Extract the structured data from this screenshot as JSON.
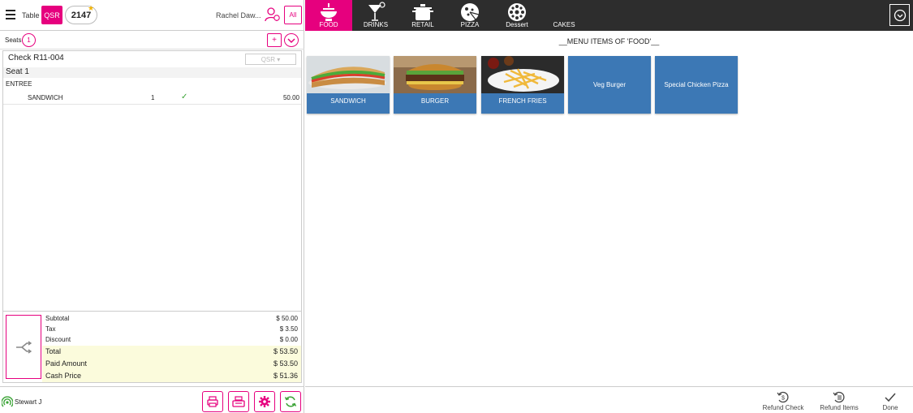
{
  "header": {
    "table_label": "Table",
    "order_type": "QSR",
    "table_number": "2147",
    "user_name": "Rachel Daw...",
    "filter_all": "All"
  },
  "seats": {
    "label": "Seats",
    "count": "1",
    "add": "+"
  },
  "check": {
    "title": "Check R11-004",
    "type_dropdown": "QSR ▾",
    "seat_heading": "Seat 1",
    "course": "ENTREE",
    "items": [
      {
        "name": "SANDWICH",
        "qty": "1",
        "amount": "50.00"
      }
    ]
  },
  "totals": {
    "subtotal_label": "Subtotal",
    "subtotal": "$ 50.00",
    "tax_label": "Tax",
    "tax": "$ 3.50",
    "discount_label": "Discount",
    "discount": "$ 0.00",
    "total_label": "Total",
    "total": "$ 53.50",
    "paid_label": "Paid Amount",
    "paid": "$ 53.50",
    "cash_label": "Cash Price",
    "cash": "$ 51.36"
  },
  "employee": {
    "name": "Stewart J"
  },
  "categories": [
    {
      "label": "FOOD",
      "icon": "bowl-icon",
      "active": true
    },
    {
      "label": "DRINKS",
      "icon": "cocktail-icon"
    },
    {
      "label": "RETAIL",
      "icon": "pot-icon"
    },
    {
      "label": "PIZZA",
      "icon": "pizza-icon"
    },
    {
      "label": "Dessert",
      "icon": "dessert-icon"
    },
    {
      "label": "CAKES",
      "icon": ""
    }
  ],
  "menu": {
    "title": "__MENU ITEMS OF 'FOOD'__",
    "items": [
      {
        "label": "SANDWICH"
      },
      {
        "label": "BURGER"
      },
      {
        "label": "FRENCH FRIES"
      },
      {
        "label": "Veg Burger"
      },
      {
        "label": "Special Chicken Pizza"
      }
    ]
  },
  "actions": {
    "refund_check": "Refund Check",
    "refund_items": "Refund Items",
    "done": "Done"
  },
  "colors": {
    "accent": "#e6007e",
    "category_bar": "#2d2d2d",
    "tile": "#3c78b5",
    "highlight": "#fbfbdc"
  }
}
